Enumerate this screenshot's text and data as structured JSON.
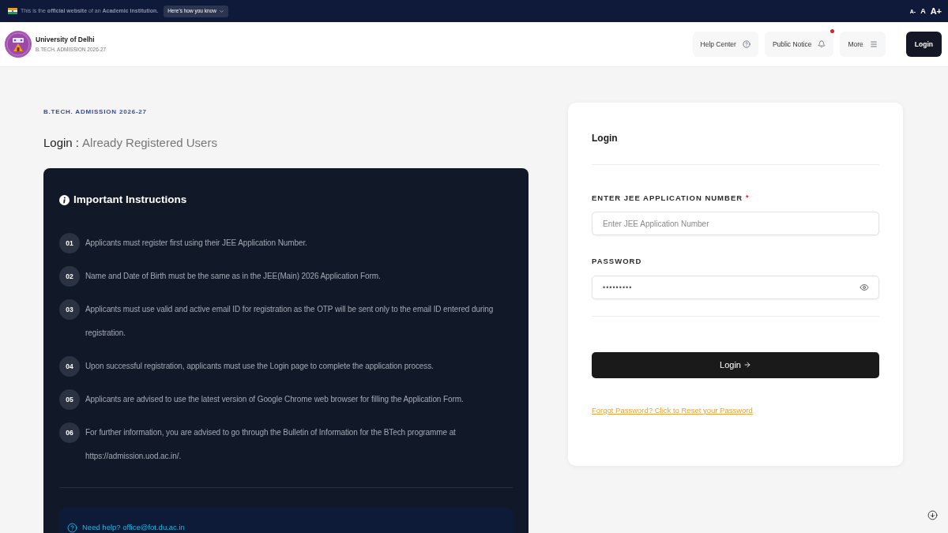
{
  "gov_banner": {
    "text": "This is the **official website** of an **Academic Institution.**",
    "button": "Here's how you know",
    "font_sizes": [
      {
        "label": "A-",
        "kind": "decrease"
      },
      {
        "label": "A",
        "kind": "normal"
      },
      {
        "label": "A+",
        "kind": "increase"
      }
    ]
  },
  "header": {
    "title": "University of Delhi",
    "subtitle": "B.TECH. ADMISSION 2026-27",
    "nav": [
      {
        "label": "Help Center",
        "kind": "help",
        "alert": false
      },
      {
        "label": "Public Notice",
        "kind": "notice",
        "alert": true
      },
      {
        "label": "More",
        "kind": "menu",
        "alert": false
      }
    ],
    "login_button": "Login"
  },
  "intro": {
    "eyebrow": "B.TECH. ADMISSION 2026-27",
    "title": "Login :",
    "subtitle": "Already Registered Users"
  },
  "instructions": {
    "title": "Important Instructions",
    "items": [
      {
        "number": "01",
        "text": "Applicants must register first using their JEE Application Number."
      },
      {
        "number": "02",
        "text": "Name and Date of Birth must be the same as in the JEE(Main) 2026 Application Form."
      },
      {
        "number": "03",
        "text": "Applicants must use valid and active email ID for registration as the OTP will be sent only to the email ID entered during registration."
      },
      {
        "number": "04",
        "text": "Upon successful registration, applicants must use the Login page to complete the application process."
      },
      {
        "number": "05",
        "text": "Applicants are advised to use the latest version of Google Chrome web browser for filling the Application Form."
      },
      {
        "number": "06",
        "text": "For further information, you are advised to go through the Bulletin of Information for the BTech programme at https://admission.uod.ac.in/."
      }
    ],
    "help": "Need help? office@fot.du.ac.in"
  },
  "login_form": {
    "title": "Login",
    "fields": [
      {
        "kind": "text",
        "label": "ENTER JEE APPLICATION NUMBER",
        "required_mark": "*",
        "placeholder": "Enter JEE Application Number"
      },
      {
        "kind": "password",
        "label": "PASSWORD",
        "value": "•••••••••"
      }
    ],
    "submit": "Login",
    "forgot_link": "Forgot Password? Click to Reset your Password"
  }
}
